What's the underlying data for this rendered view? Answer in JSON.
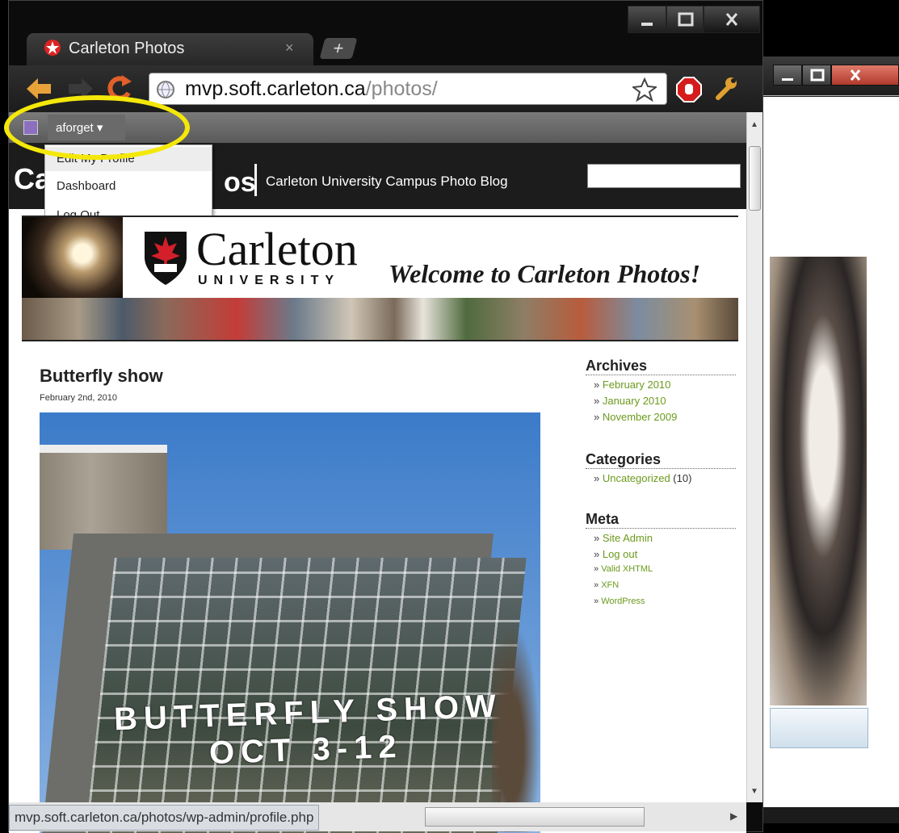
{
  "browser": {
    "tab_title": "Carleton Photos",
    "tab_close": "×",
    "new_tab": "+",
    "url_host": "mvp.soft.carleton.ca",
    "url_path": "/photos/",
    "status_url": "mvp.soft.carleton.ca/photos/wp-admin/profile.php"
  },
  "adminbar": {
    "user": "aforget ▾",
    "menu": [
      "Edit My Profile",
      "Dashboard",
      "Log Out"
    ]
  },
  "header": {
    "title_left": "Ca",
    "title_right": "os",
    "tagline": "Carleton University Campus Photo Blog"
  },
  "banner": {
    "name": "Carleton",
    "university": "UNIVERSITY",
    "welcome": "Welcome to Carleton Photos!"
  },
  "post": {
    "title": "Butterfly show",
    "date": "February 2nd, 2010",
    "sign_line1": "BUTTERFLY SHOW",
    "sign_line2": "OCT 3-12"
  },
  "sidebar": {
    "archives_title": "Archives",
    "archives": [
      "February 2010",
      "January 2010",
      "November 2009"
    ],
    "categories_title": "Categories",
    "category": "Uncategorized",
    "category_count": "(10)",
    "meta_title": "Meta",
    "meta": [
      "Site Admin",
      "Log out",
      "Valid XHTML",
      "XFN",
      "WordPress"
    ]
  },
  "icons": {
    "back": "back-arrow-icon",
    "forward": "forward-arrow-icon",
    "reload": "reload-icon",
    "star": "star-icon",
    "stop": "stop-extension-icon",
    "wrench": "wrench-icon"
  },
  "colors": {
    "link_green": "#6b9a1c",
    "annotation_yellow": "#f4e80a",
    "header_dark": "#1c1c1c"
  }
}
